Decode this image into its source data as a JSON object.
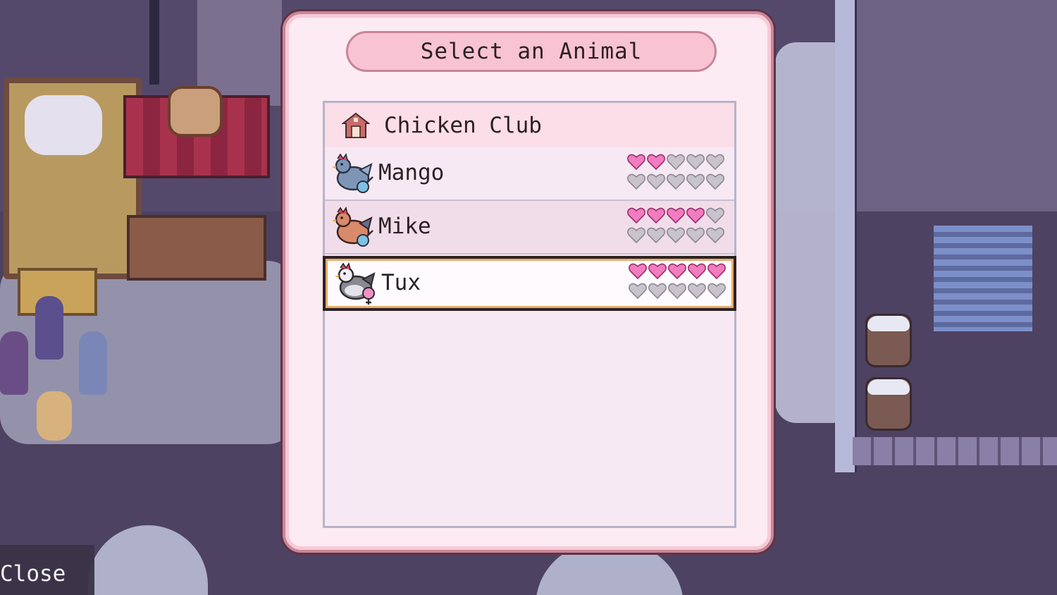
{
  "dialog": {
    "title": "Select an Animal",
    "group": {
      "label": "Chicken Club",
      "icon": "barn-icon"
    },
    "animals": [
      {
        "name": "Mango",
        "icon": "blue-chicken-icon",
        "gender_icon": "male-icon",
        "hearts_filled": 2,
        "hearts_total": 10,
        "selected": false
      },
      {
        "name": "Mike",
        "icon": "orange-chicken-icon",
        "gender_icon": "male-icon",
        "hearts_filled": 4,
        "hearts_total": 10,
        "selected": false
      },
      {
        "name": "Tux",
        "icon": "gray-chicken-icon",
        "gender_icon": "female-icon",
        "hearts_filled": 5,
        "hearts_total": 10,
        "selected": true
      }
    ]
  },
  "hint": {
    "close_label": "Close"
  },
  "colors": {
    "heart_filled": "#f27cc0",
    "heart_empty": "#c8c3cc",
    "selection_border": "#e6ad6b",
    "modal_bg": "#fcebf3",
    "title_pill": "#f8c3d3"
  }
}
